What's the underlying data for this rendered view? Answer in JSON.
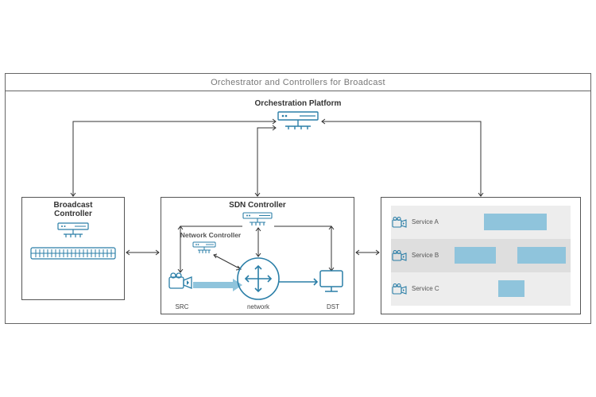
{
  "title": "Orchestrator and Controllers for Broadcast",
  "orchestration_label": "Orchestration Platform",
  "broadcast": {
    "label": "Broadcast\nController"
  },
  "sdn": {
    "label": "SDN Controller",
    "network_controller_label": "Network Controller",
    "src_label": "SRC",
    "dst_label": "DST",
    "network_label": "network"
  },
  "services": {
    "row_a": "Service A",
    "row_b": "Service B",
    "row_c": "Service C"
  },
  "colors": {
    "accent": "#8fc4dc",
    "accent_stroke": "#2a7ea7",
    "gray_border": "#666"
  }
}
